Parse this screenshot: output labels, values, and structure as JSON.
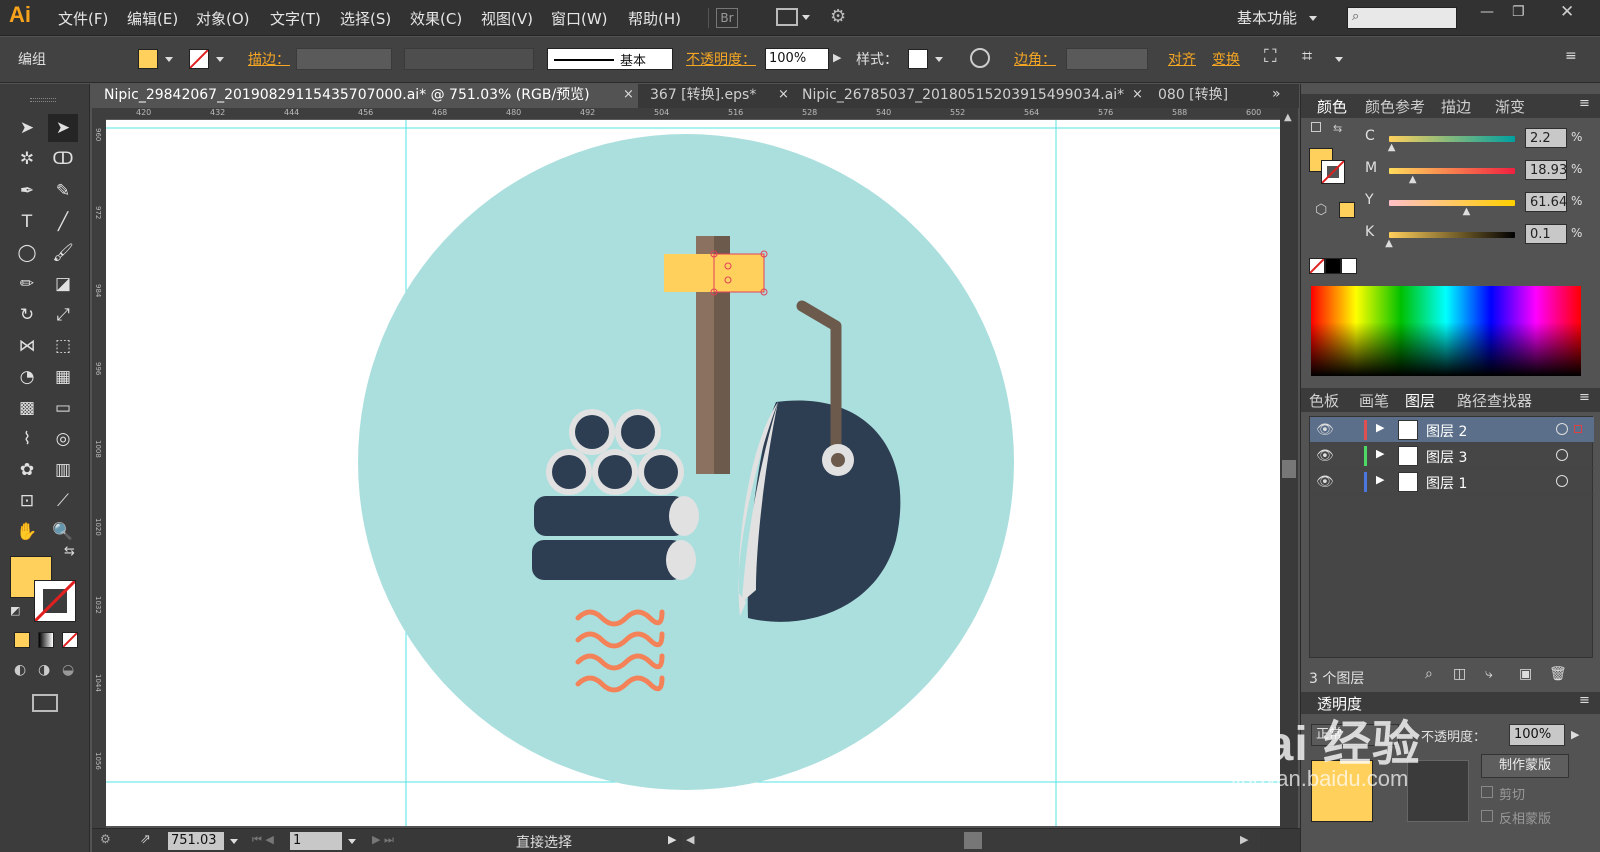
{
  "app": {
    "logo": "Ai",
    "workspace": "基本功能"
  },
  "menu": [
    "文件(F)",
    "编辑(E)",
    "对象(O)",
    "文字(T)",
    "选择(S)",
    "效果(C)",
    "视图(V)",
    "窗口(W)",
    "帮助(H)"
  ],
  "menu_extras": {
    "bridge": "Br"
  },
  "control": {
    "selection_label": "编组",
    "stroke_label": "描边：",
    "stroke_style": "基本",
    "opacity_label": "不透明度：",
    "opacity_value": "100%",
    "style_label": "样式：",
    "corner_label": "边角：",
    "align_label": "对齐",
    "transform_label": "变换",
    "fill_color": "#ffd05c"
  },
  "tabs": [
    {
      "label": "Nipic_29842067_20190829115435707000.ai* @ 751.03% (RGB/预览)",
      "active": true
    },
    {
      "label": "367 [转换].eps*",
      "active": false
    },
    {
      "label": "Nipic_26785037_20180515203915499034.ai*",
      "active": false
    },
    {
      "label": "080 [转换]",
      "active": false
    }
  ],
  "rulers": {
    "h": [
      "420",
      "432",
      "444",
      "456",
      "468",
      "480",
      "492",
      "504",
      "516",
      "528",
      "540",
      "552",
      "564",
      "576",
      "588",
      "600"
    ],
    "v": [
      "960",
      "972",
      "984",
      "996",
      "1008",
      "1020",
      "1032",
      "1044",
      "1056"
    ]
  },
  "status": {
    "zoom": "751.03",
    "page": "1",
    "tool": "直接选择"
  },
  "color_panel": {
    "tabs": [
      "颜色",
      "颜色参考",
      "描边",
      "渐变"
    ],
    "channels": [
      {
        "label": "C",
        "value": "2.2",
        "pct": 0.022
      },
      {
        "label": "M",
        "value": "18.93",
        "pct": 0.1893
      },
      {
        "label": "Y",
        "value": "61.64",
        "pct": 0.6164
      },
      {
        "label": "K",
        "value": "0.1",
        "pct": 0.001
      }
    ],
    "unit": "%"
  },
  "layers_panel": {
    "tabs": [
      "色板",
      "画笔",
      "图层",
      "路径查找器"
    ],
    "layers": [
      {
        "name": "图层 2",
        "color": "#e05050",
        "selected": true
      },
      {
        "name": "图层 3",
        "color": "#4cd964",
        "selected": false
      },
      {
        "name": "图层 1",
        "color": "#4a78e0",
        "selected": false
      }
    ],
    "count": "3 个图层"
  },
  "transparency_panel": {
    "title": "透明度",
    "mode": "正常",
    "opacity_label": "不透明度：",
    "opacity_value": "100%",
    "make_mask": "制作蒙版",
    "clip": "剪切",
    "invert": "反相蒙版"
  },
  "watermark": {
    "text": "Bai 经验",
    "sub": "jingyan.baidu.com"
  },
  "artwork_colors": {
    "bg_circle": "#abdfde",
    "navy": "#2d3d52",
    "wood": "#8a7160",
    "wood_dark": "#6c5a4d",
    "yellow": "#ffd05c",
    "gray": "#e1e1e1",
    "orange": "#f48259"
  }
}
